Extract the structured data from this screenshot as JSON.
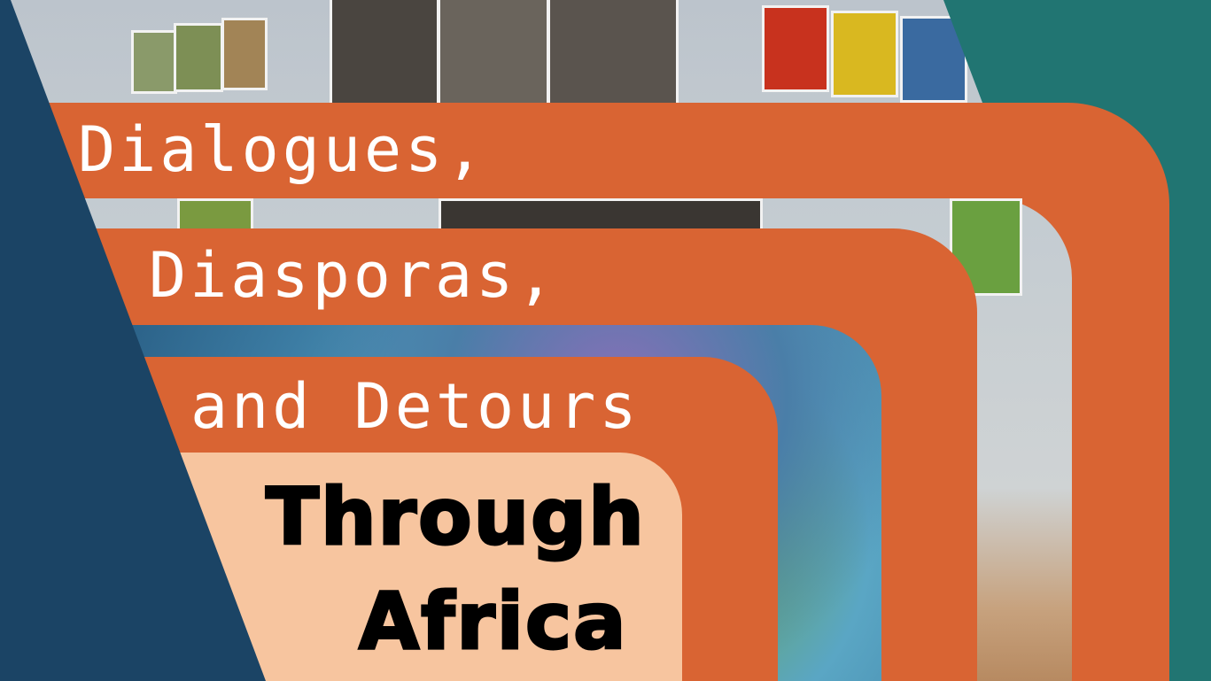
{
  "title": {
    "line1": "Dialogues,",
    "line2": "Diasporas,",
    "line3": "and Detours",
    "line4": "Through",
    "line5": "Africa"
  },
  "colors": {
    "orange": "#d96433",
    "peach": "#f7c59f",
    "navy": "#1b4465",
    "teal": "#217572"
  }
}
